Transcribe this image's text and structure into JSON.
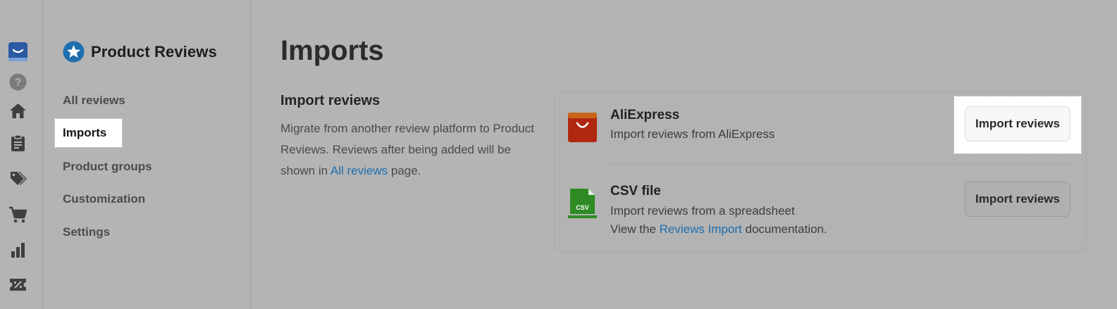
{
  "app": {
    "brand_title": "Product Reviews"
  },
  "rail": {
    "icons": [
      "app-logo-icon",
      "help-icon",
      "home-icon",
      "clipboard-icon",
      "tags-icon",
      "cart-icon",
      "bar-chart-icon",
      "discount-ticket-icon"
    ]
  },
  "sidebar": {
    "items": [
      {
        "label": "All reviews"
      },
      {
        "label": "Imports",
        "active": true
      },
      {
        "label": "Product groups"
      },
      {
        "label": "Customization"
      },
      {
        "label": "Settings"
      }
    ]
  },
  "main": {
    "page_title": "Imports",
    "section": {
      "title": "Import reviews",
      "desc_part1": "Migrate from another review platform to Product Reviews. Reviews after being added will be shown in ",
      "desc_link": "All reviews",
      "desc_part2": " page."
    },
    "sources": [
      {
        "name": "AliExpress",
        "subtitle": "Import reviews from AliExpress",
        "button_label": "Import reviews",
        "icon": "aliexpress-bag-icon"
      },
      {
        "name": "CSV file",
        "subtitle": "Import reviews from a spreadsheet",
        "doc_prefix": "View the ",
        "doc_link": "Reviews Import",
        "doc_suffix": " documentation.",
        "icon_text": "CSV",
        "button_label": "Import reviews",
        "icon": "csv-file-icon"
      }
    ]
  },
  "colors": {
    "background": "#b4b4b4",
    "link": "#1f6fae",
    "brand_blue": "#1f6fae",
    "aliexpress_red": "#b2270f",
    "csv_green": "#2e8b23"
  }
}
